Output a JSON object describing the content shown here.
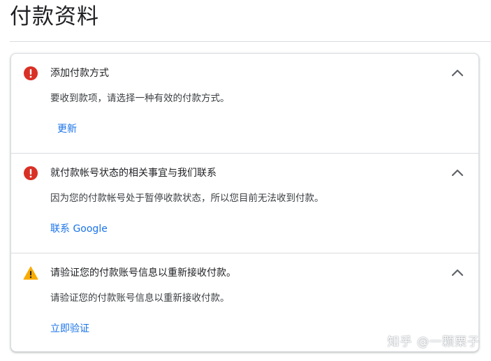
{
  "page": {
    "title": "付款资料"
  },
  "sections": [
    {
      "icon": "error-icon",
      "icon_color": "#d93025",
      "title": "添加付款方式",
      "body": "要收到款项，请选择一种有效的付款方式。",
      "link": "更新"
    },
    {
      "icon": "error-icon",
      "icon_color": "#d93025",
      "title": "就付款帐号状态的相关事宜与我们联系",
      "body": "因为您的付款帐号处于暂停收款状态，所以您目前无法收到付款。",
      "link": "联系 Google"
    },
    {
      "icon": "warning-icon",
      "icon_color": "#f9ab00",
      "title": "请验证您的付款账号信息以重新接收付款。",
      "body": "请验证您的付款账号信息以重新接收付款。",
      "link": "立即验证"
    }
  ],
  "colors": {
    "link": "#1a73e8",
    "error": "#d93025",
    "warning": "#f9ab00"
  },
  "watermark": {
    "text": "知乎 @一颗栗子"
  }
}
